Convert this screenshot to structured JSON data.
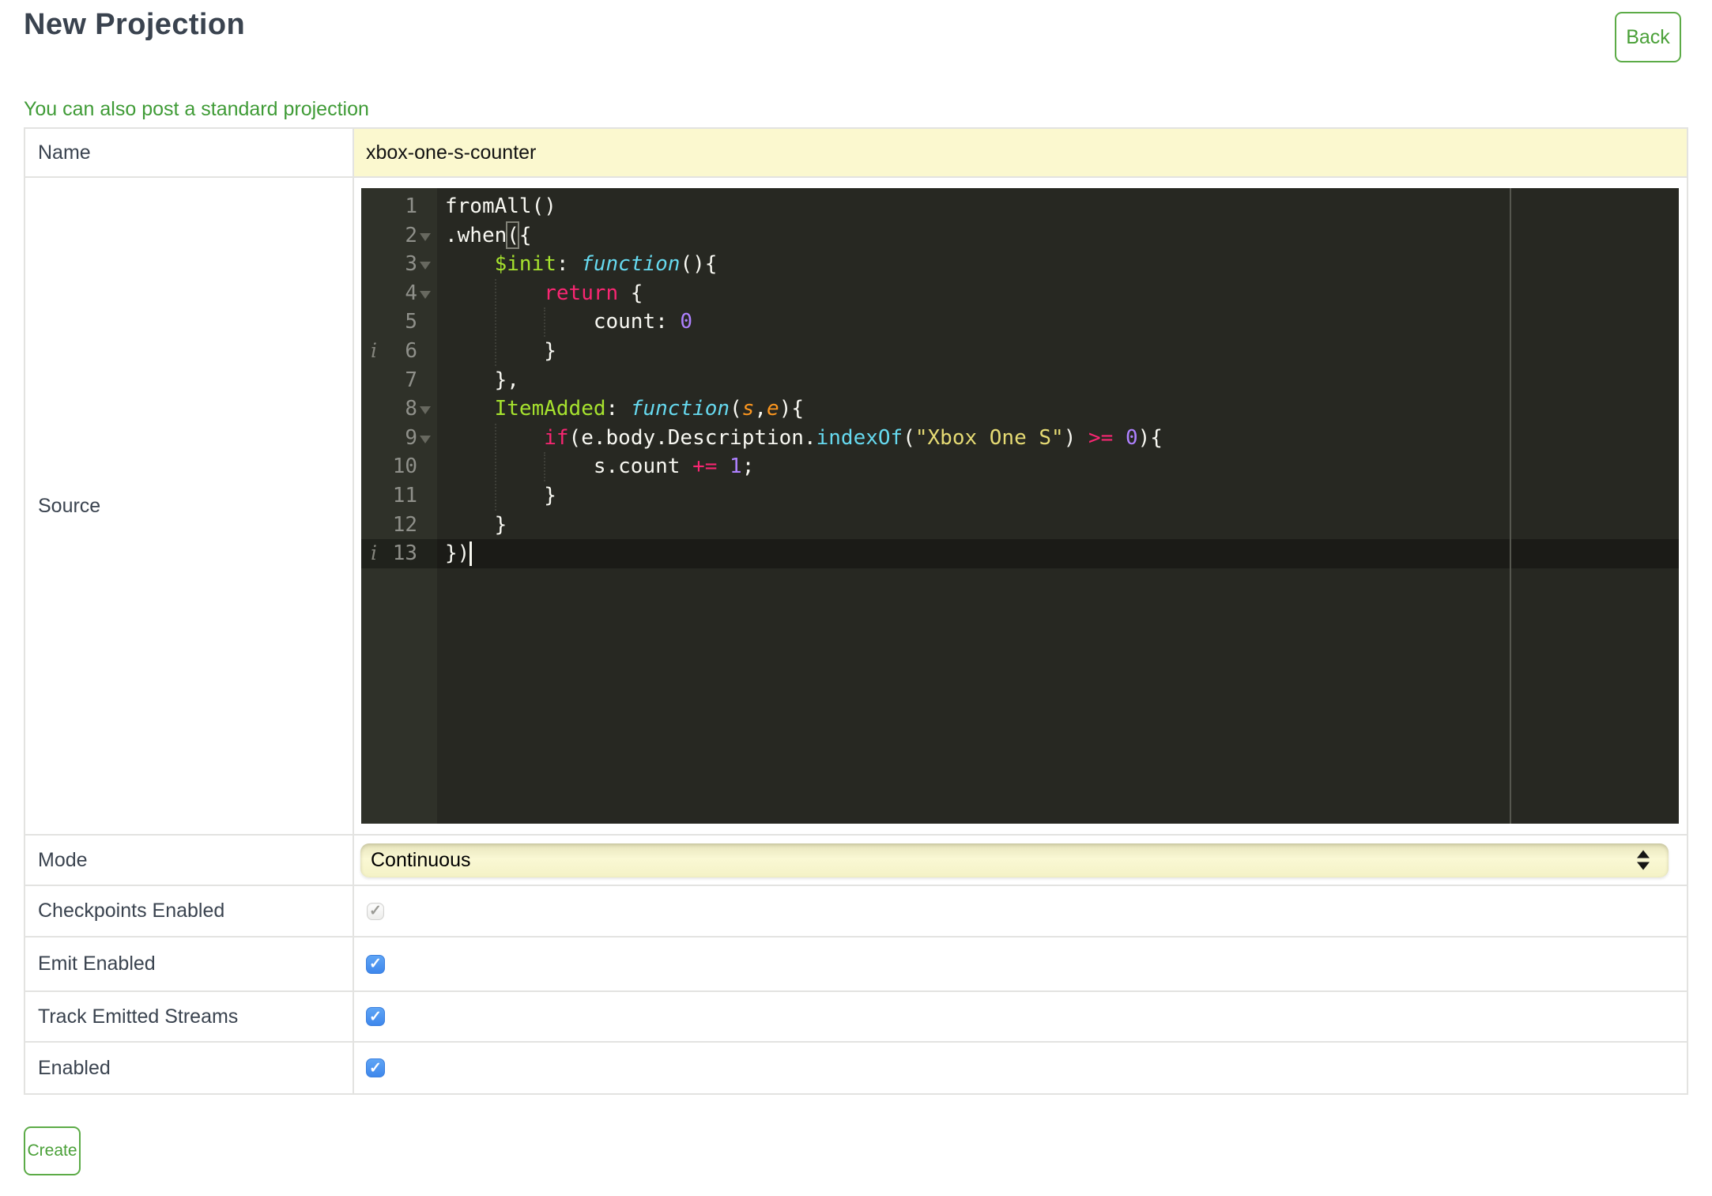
{
  "header": {
    "title": "New Projection",
    "back_label": "Back"
  },
  "note_link": "You can also post a standard projection",
  "form": {
    "rows": [
      {
        "label": "Name"
      },
      {
        "label": "Source"
      },
      {
        "label": "Mode"
      },
      {
        "label": "Checkpoints Enabled"
      },
      {
        "label": "Emit Enabled"
      },
      {
        "label": "Track Emitted Streams"
      },
      {
        "label": "Enabled"
      }
    ],
    "name_value": "xbox-one-s-counter",
    "mode_value": "Continuous",
    "checkbox_states": {
      "checkpoints": {
        "checked": true,
        "disabled": true
      },
      "emit": {
        "checked": true,
        "disabled": false
      },
      "track": {
        "checked": true,
        "disabled": false
      },
      "enabled": {
        "checked": true,
        "disabled": false
      }
    }
  },
  "actions": {
    "create_label": "Create"
  },
  "editor": {
    "info_glyph": "i",
    "lines": [
      {
        "n": 1,
        "fold": false,
        "info": false,
        "active": false,
        "tokens": [
          [
            "p",
            "fromAll()"
          ]
        ]
      },
      {
        "n": 2,
        "fold": true,
        "info": false,
        "active": false,
        "tokens": [
          [
            "p",
            ".when({"
          ]
        ]
      },
      {
        "n": 3,
        "fold": true,
        "info": false,
        "active": false,
        "tokens": [
          [
            "p",
            "    "
          ],
          [
            "f",
            "$init"
          ],
          [
            "p",
            ": "
          ],
          [
            "s",
            "function"
          ],
          [
            "p",
            "(){"
          ]
        ]
      },
      {
        "n": 4,
        "fold": true,
        "info": false,
        "active": false,
        "tokens": [
          [
            "p",
            "        "
          ],
          [
            "k",
            "return"
          ],
          [
            "p",
            " {"
          ]
        ]
      },
      {
        "n": 5,
        "fold": false,
        "info": false,
        "active": false,
        "tokens": [
          [
            "p",
            "            count: "
          ],
          [
            "n",
            "0"
          ]
        ]
      },
      {
        "n": 6,
        "fold": false,
        "info": true,
        "active": false,
        "tokens": [
          [
            "p",
            "        }"
          ]
        ]
      },
      {
        "n": 7,
        "fold": false,
        "info": false,
        "active": false,
        "tokens": [
          [
            "p",
            "    },"
          ]
        ]
      },
      {
        "n": 8,
        "fold": true,
        "info": false,
        "active": false,
        "tokens": [
          [
            "p",
            "    "
          ],
          [
            "f",
            "ItemAdded"
          ],
          [
            "p",
            ": "
          ],
          [
            "s",
            "function"
          ],
          [
            "p",
            "("
          ],
          [
            "a",
            "s"
          ],
          [
            "p",
            ","
          ],
          [
            "a",
            "e"
          ],
          [
            "p",
            "){"
          ]
        ]
      },
      {
        "n": 9,
        "fold": true,
        "info": false,
        "active": false,
        "tokens": [
          [
            "p",
            "        "
          ],
          [
            "k",
            "if"
          ],
          [
            "p",
            "(e.body.Description."
          ],
          [
            "u",
            "indexOf"
          ],
          [
            "p",
            "("
          ],
          [
            "t",
            "\"Xbox One S\""
          ],
          [
            "p",
            ") "
          ],
          [
            "k",
            ">="
          ],
          [
            "p",
            " "
          ],
          [
            "n",
            "0"
          ],
          [
            "p",
            "){"
          ]
        ]
      },
      {
        "n": 10,
        "fold": false,
        "info": false,
        "active": false,
        "tokens": [
          [
            "p",
            "            s.count "
          ],
          [
            "k",
            "+="
          ],
          [
            "p",
            " "
          ],
          [
            "n",
            "1"
          ],
          [
            "p",
            ";"
          ]
        ]
      },
      {
        "n": 11,
        "fold": false,
        "info": false,
        "active": false,
        "tokens": [
          [
            "p",
            "        }"
          ]
        ]
      },
      {
        "n": 12,
        "fold": false,
        "info": false,
        "active": false,
        "tokens": [
          [
            "p",
            "    }"
          ]
        ]
      },
      {
        "n": 13,
        "fold": false,
        "info": true,
        "active": true,
        "tokens": [
          [
            "p",
            "})"
          ]
        ]
      }
    ]
  },
  "colors": {
    "accent_green": "#4AA038",
    "border_green": "#5CAB47",
    "link_green": "#3F9B36",
    "heading": "#3A434F",
    "field_yellow": "#FBF8CF",
    "checkbox_blue": "#4A94EF",
    "ed-bg": "#272822",
    "ed-gutter": "#2F3129",
    "ed-lnum": "#8F908A",
    "text": "#F8F8F2",
    "keyword": "#F92672",
    "function_name": "#A6E22E",
    "storage": "#66D9EF",
    "support": "#66D9EF",
    "param": "#FD971F",
    "string": "#E6DB74",
    "number": "#AE81FF"
  }
}
